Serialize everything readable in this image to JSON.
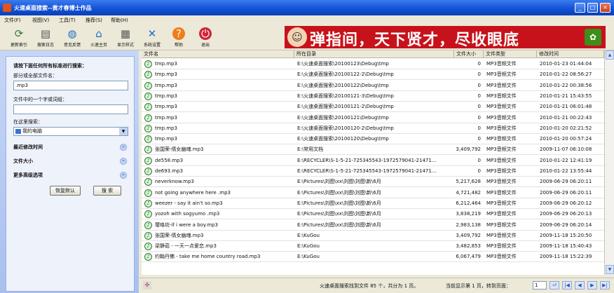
{
  "window": {
    "title": "火速桌面搜索--黄才春博士作品",
    "controls": {
      "minimize": "_",
      "maximize": "□",
      "close": "×"
    }
  },
  "menu": [
    "文件(F)",
    "视图(V)",
    "工具(T)",
    "推荐(S)",
    "帮助(H)"
  ],
  "toolbar": [
    {
      "label": "更新索引",
      "icon": "refresh-index-icon",
      "glyph": "⟳"
    },
    {
      "label": "搜索日志",
      "icon": "book-icon",
      "glyph": "▤"
    },
    {
      "label": "意见反馈",
      "icon": "globe-icon",
      "glyph": "◍"
    },
    {
      "label": "火速主页",
      "icon": "home-icon",
      "glyph": "⌂"
    },
    {
      "label": "显示样式",
      "icon": "grid-view-icon",
      "glyph": "▦"
    },
    {
      "label": "系统设置",
      "icon": "tools-icon",
      "glyph": "✕"
    },
    {
      "label": "帮助",
      "icon": "help-icon",
      "glyph": "?"
    },
    {
      "label": "退出",
      "icon": "power-icon",
      "glyph": "⏻"
    }
  ],
  "banner": {
    "text": "弹指间，天下贤才，尽收眼底",
    "color": "#c8121b"
  },
  "sidebar": {
    "heading": "请按下面任何所有标准进行搜索：",
    "filename_label": "部分或全部文件名：",
    "filename_value": ".mp3",
    "phrase_label": "文件中的一个字或词组：",
    "phrase_value": "",
    "location_label": "在这里搜索：",
    "location_value": "我的电脑",
    "modified_label": "最近修改时间",
    "size_label": "文件大小",
    "advanced_label": "更多高级选项",
    "reset_button": "恢复默认",
    "search_button": "搜 索"
  },
  "table": {
    "headers": [
      "文件名",
      "所在目录",
      "文件大小",
      "文件类型",
      "修改时间"
    ],
    "rows": [
      {
        "name": "tmp.mp3",
        "dir": "E:\\火速桌面搜索\\20100123\\Debug\\tmp",
        "size": "0",
        "type": "MP3音频文件",
        "time": "2010-01-23 01:44:04"
      },
      {
        "name": "tmp.mp3",
        "dir": "E:\\火速桌面搜索\\20100122-2\\Debug\\tmp",
        "size": "0",
        "type": "MP3音频文件",
        "time": "2010-01-22 08:56:27"
      },
      {
        "name": "tmp.mp3",
        "dir": "E:\\火速桌面搜索\\20100122\\Debug\\tmp",
        "size": "0",
        "type": "MP3音频文件",
        "time": "2010-01-22 00:38:56"
      },
      {
        "name": "tmp.mp3",
        "dir": "E:\\火速桌面搜索\\20100121-3\\Debug\\tmp",
        "size": "0",
        "type": "MP3音频文件",
        "time": "2010-01-21 15:43:55"
      },
      {
        "name": "tmp.mp3",
        "dir": "E:\\火速桌面搜索\\20100121-2\\Debug\\tmp",
        "size": "0",
        "type": "MP3音频文件",
        "time": "2010-01-21 06:01:48"
      },
      {
        "name": "tmp.mp3",
        "dir": "E:\\火速桌面搜索\\20100121\\Debug\\tmp",
        "size": "0",
        "type": "MP3音频文件",
        "time": "2010-01-21 00:22:43"
      },
      {
        "name": "tmp.mp3",
        "dir": "E:\\火速桌面搜索\\20100120-2\\Debug\\tmp",
        "size": "0",
        "type": "MP3音频文件",
        "time": "2010-01-20 02:21:52"
      },
      {
        "name": "tmp.mp3",
        "dir": "E:\\火速桌面搜索\\20100120\\Debug\\tmp",
        "size": "0",
        "type": "MP3音频文件",
        "time": "2010-01-20 00:57:24"
      },
      {
        "name": "张国荣-倩女幽魂.mp3",
        "dir": "E:\\常用文档",
        "size": "3,409,792",
        "type": "MP3音频文件",
        "time": "2009-11-07 06:10:08"
      },
      {
        "name": "de558.mp3",
        "dir": "E:\\RECYCLER\\S-1-5-21-725345543-1972579041-21471...",
        "size": "0",
        "type": "MP3音频文件",
        "time": "2010-01-22 12:41:19"
      },
      {
        "name": "de693.mp3",
        "dir": "E:\\RECYCLER\\S-1-5-21-725345543-1972579041-21471...",
        "size": "0",
        "type": "MP3音频文件",
        "time": "2010-01-22 13:55:44"
      },
      {
        "name": "neverknow.mp3",
        "dir": "E:\\Pictures\\刘图\\xx\\刘图\\刘图\\新\\6月",
        "size": "5,217,628",
        "type": "MP3音频文件",
        "time": "2009-06-29 06:20:11"
      },
      {
        "name": "not going anywhere here .mp3",
        "dir": "E:\\Pictures\\刘图\\xx\\刘图\\刘图\\新\\6月",
        "size": "4,721,482",
        "type": "MP3音频文件",
        "time": "2009-06-29 06:20:11"
      },
      {
        "name": "weezer - say it ain't so.mp3",
        "dir": "E:\\Pictures\\刘图\\xx\\刘图\\刘图\\新\\6月",
        "size": "6,212,464",
        "type": "MP3音频文件",
        "time": "2009-06-29 06:20:12"
      },
      {
        "name": "yozoh with sogyumo .mp3",
        "dir": "E:\\Pictures\\刘图\\xx\\刘图\\刘图\\新\\6月",
        "size": "3,838,219",
        "type": "MP3音频文件",
        "time": "2009-06-29 06:20:13"
      },
      {
        "name": "璎珞坊-if i were a boy.mp3",
        "dir": "E:\\Pictures\\刘图\\xx\\刘图\\刘图\\新\\6月",
        "size": "2,983,138",
        "type": "MP3音频文件",
        "time": "2009-06-29 06:20:14"
      },
      {
        "name": "张国荣-倩女幽魂.mp3",
        "dir": "E:\\KuGou",
        "size": "3,409,792",
        "type": "MP3音频文件",
        "time": "2009-11-18 15:20:50"
      },
      {
        "name": "梁静茹 - 一天一点爱恋.mp3",
        "dir": "E:\\KuGou",
        "size": "3,482,853",
        "type": "MP3音频文件",
        "time": "2009-11-18 15:40:43"
      },
      {
        "name": "约翰丹佛 - take me home country road.mp3",
        "dir": "E:\\KuGou",
        "size": "6,067,479",
        "type": "MP3音频文件",
        "time": "2009-11-18 15:22:39"
      }
    ]
  },
  "status": {
    "summary": "火速桌面搜索找到文件 85 个，共分为 1 页。",
    "current": "当前显示第 1 页，转到页面：",
    "page_value": "1"
  },
  "colors": {
    "title_blue": "#1452d6",
    "banner_red": "#c8121b",
    "sidebar_blue": "#a9c0ee"
  }
}
